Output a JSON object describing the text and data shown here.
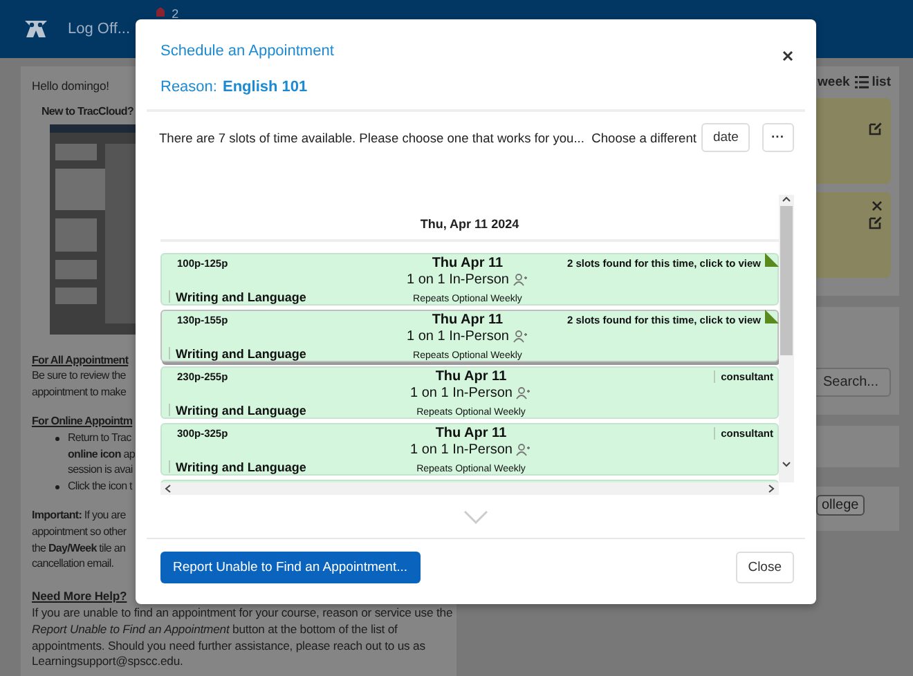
{
  "top_bar": {
    "log_off": "Log Off...",
    "notification_count": "2"
  },
  "page": {
    "greeting": "Hello domingo!",
    "intro_heading": "New to TracCloud?",
    "lines": [
      {
        "kind": "heading",
        "text": "For All Appointment"
      },
      {
        "kind": "text",
        "text": "Be sure to review the"
      },
      {
        "kind": "text",
        "text": "appointment to make"
      },
      {
        "kind": "heading",
        "text": "For Online Appointm"
      },
      {
        "kind": "bullet",
        "text": "Return to Trac"
      },
      {
        "kind": "cont",
        "text": "**online icon** ap"
      },
      {
        "kind": "cont",
        "text": "session is avai"
      },
      {
        "kind": "bullet",
        "text": "Click the icon t"
      },
      {
        "kind": "gap",
        "text": "**Important:** If you are"
      },
      {
        "kind": "text",
        "text": "appointment so other"
      },
      {
        "kind": "text",
        "text": "the **Day/Week** tile an"
      },
      {
        "kind": "text",
        "text": "cancellation email."
      },
      {
        "kind": "heading",
        "text": "Need More Help?"
      },
      {
        "kind": "text",
        "text": "If you are unable to find an appointment for your course, reason or service use the"
      },
      {
        "kind": "text",
        "text": "*Report Unable to Find an Appointment* button at the bottom of the list of"
      },
      {
        "kind": "text",
        "text": "appointments. Should you need further assistance, please reach out to us as"
      },
      {
        "kind": "text",
        "text": "Learningsupport@spscc.edu."
      }
    ],
    "view_week": "week",
    "view_list": "list",
    "search_button": "Search...",
    "tag": "ollege"
  },
  "modal": {
    "title": "Schedule an Appointment",
    "reason_label": "Reason:",
    "reason": "English 101",
    "message": "There are 7 slots of time available. Please choose one that works for you...  Choose a different",
    "date_button": "date",
    "more_button": "···",
    "day_header": "Thu, Apr 11 2024",
    "slots": [
      {
        "kind": "multi",
        "time": "100p-125p",
        "date": "Thu Apr 11",
        "mode": "1 on 1 In-Person",
        "subject": "Writing and Language",
        "repeats": "Repeats Optional Weekly",
        "note": "2 slots found for this time, click to view",
        "selected": false
      },
      {
        "kind": "multi",
        "time": "130p-155p",
        "date": "Thu Apr 11",
        "mode": "1 on 1 In-Person",
        "subject": "Writing and Language",
        "repeats": "Repeats Optional Weekly",
        "note": "2 slots found for this time, click to view",
        "selected": true
      },
      {
        "kind": "single",
        "time": "230p-255p",
        "date": "Thu Apr 11",
        "mode": "1 on 1 In-Person",
        "subject": "Writing and Language",
        "repeats": "Repeats Optional Weekly",
        "note": "consultant",
        "selected": false
      },
      {
        "kind": "single",
        "time": "300p-325p",
        "date": "Thu Apr 11",
        "mode": "1 on 1 In-Person",
        "subject": "Writing and Language",
        "repeats": "Repeats Optional Weekly",
        "note": "consultant",
        "selected": false
      }
    ],
    "report_button": "Report Unable to Find an Appointment...",
    "close_button": "Close"
  }
}
